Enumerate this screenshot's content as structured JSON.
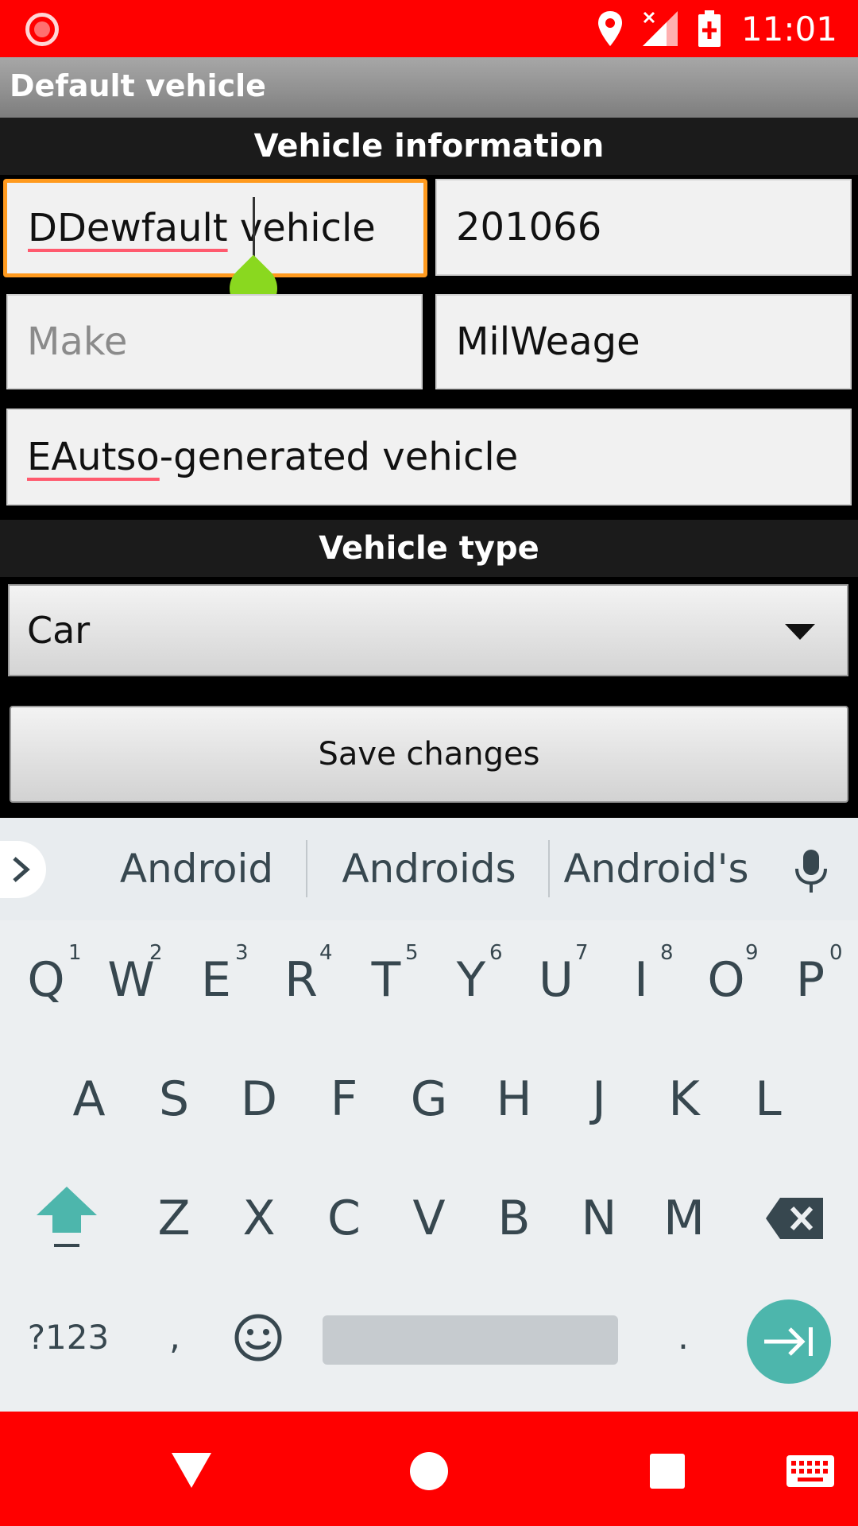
{
  "status_bar": {
    "time": "11:01",
    "icons": [
      "screen-record-icon",
      "location-icon",
      "signal-no-data-icon",
      "battery-charging-icon"
    ]
  },
  "app": {
    "title": "Default vehicle"
  },
  "sections": {
    "info_header": "Vehicle information",
    "type_header": "Vehicle type"
  },
  "fields": {
    "name": {
      "value_underlined": "DDewfault",
      "value_rest": " vehicle"
    },
    "year": {
      "value": "201066"
    },
    "make": {
      "placeholder": "Make",
      "value": ""
    },
    "mileage": {
      "value": "MilWeage"
    },
    "description": {
      "value_underlined": "EAutso",
      "value_rest": "-generated vehicle"
    }
  },
  "vehicle_type": {
    "selected": "Car"
  },
  "save_button": {
    "label": "Save changes"
  },
  "keyboard": {
    "suggestions": [
      "Android",
      "Androids",
      "Android's"
    ],
    "row1": [
      "Q",
      "W",
      "E",
      "R",
      "T",
      "Y",
      "U",
      "I",
      "O",
      "P"
    ],
    "row1_hints": [
      "1",
      "2",
      "3",
      "4",
      "5",
      "6",
      "7",
      "8",
      "9",
      "0"
    ],
    "row2": [
      "A",
      "S",
      "D",
      "F",
      "G",
      "H",
      "J",
      "K",
      "L"
    ],
    "row3": [
      "Z",
      "X",
      "C",
      "V",
      "B",
      "N",
      "M"
    ],
    "symbols_key": "?123",
    "comma_key": ",",
    "period_key": "."
  },
  "colors": {
    "status_bar": "#ff0000",
    "focus_border": "#ff9a1e",
    "cursor_handle": "#8ad81f",
    "enter_key": "#4db6ac",
    "spell_underline": "#ff5a6e"
  }
}
